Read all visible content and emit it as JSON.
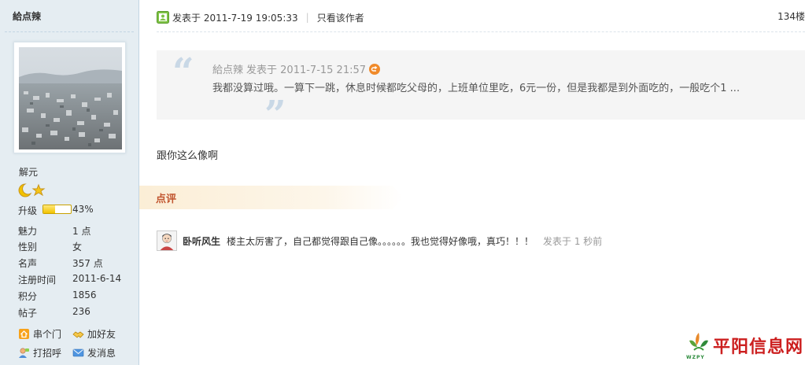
{
  "author": {
    "name": "給点辣",
    "rank_title": "解元",
    "upgrade_label": "升级",
    "upgrade_progress_pct": 43,
    "upgrade_percent_text": "43%"
  },
  "stats": [
    {
      "label": "魅力",
      "value": "1 点"
    },
    {
      "label": "性别",
      "value": "女"
    },
    {
      "label": "名声",
      "value": "357 点"
    },
    {
      "label": "注册时间",
      "value": "2011-6-14"
    },
    {
      "label": "积分",
      "value": "1856"
    },
    {
      "label": "帖子",
      "value": "236"
    }
  ],
  "actions": {
    "visit": "串个门",
    "add_friend": "加好友",
    "greet": "打招呼",
    "message": "发消息"
  },
  "post": {
    "time": "发表于 2011-7-19 19:05:33",
    "separator": "|",
    "only_author": "只看该作者",
    "post_number": "134楼"
  },
  "quote": {
    "author": "給点辣",
    "time": "发表于 2011-7-15 21:57",
    "text": "我都没算过哦。一算下一跳，休息时候都吃父母的，上班单位里吃，6元一份，但是我都是到外面吃的，一般吃个1 ..."
  },
  "reply_text": "跟你这么像啊",
  "review": {
    "label": "点评"
  },
  "comment": {
    "user": "卧听风生",
    "text": "楼主太厉害了，自己都觉得跟自己像。。。。。。我也觉得好像哦，真巧！！！",
    "time": "发表于 1 秒前"
  },
  "watermark": {
    "text": "平阳信息网",
    "sub": "WZPY"
  },
  "colors": {
    "sidebar_bg": "#e5edf2",
    "review_label": "#c1552e",
    "quote_bg": "#f5f5f5",
    "watermark_red": "#cc1f1f"
  }
}
